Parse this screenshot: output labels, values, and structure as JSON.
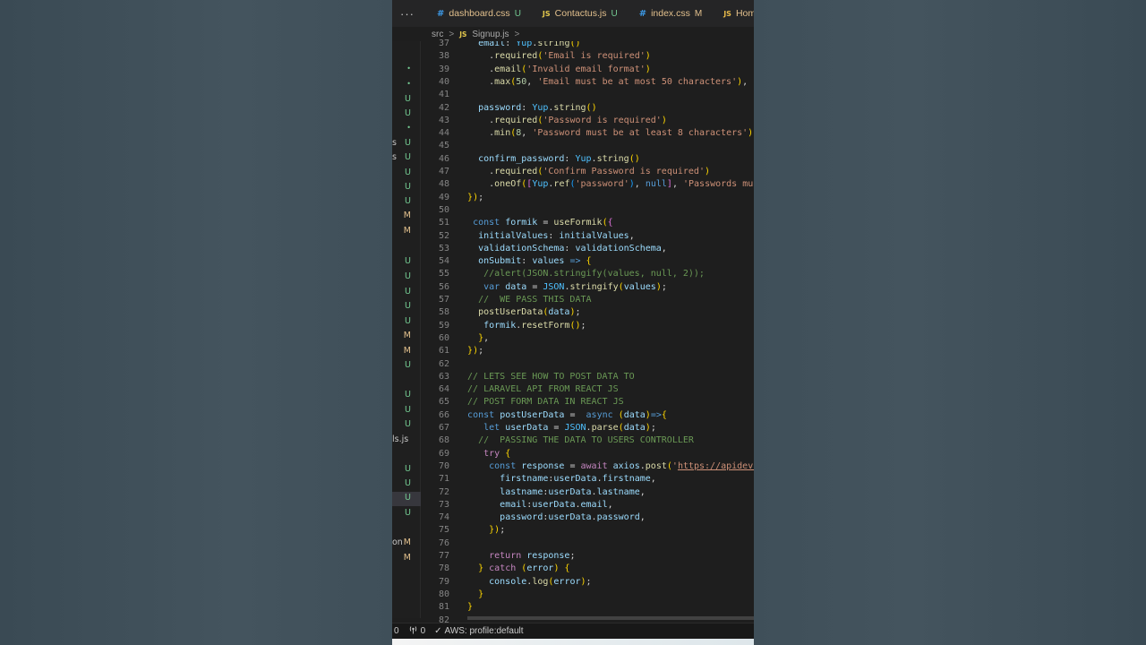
{
  "tabs": [
    {
      "icon": "#",
      "icon_kind": "css",
      "name": "dashboard.css",
      "status": "U"
    },
    {
      "icon": "JS",
      "icon_kind": "js",
      "name": "Contactus.js",
      "status": "U"
    },
    {
      "icon": "#",
      "icon_kind": "css",
      "name": "index.css",
      "status": "M"
    },
    {
      "icon": "JS",
      "icon_kind": "react",
      "name": "Hom",
      "status": ""
    }
  ],
  "tab_more": "···",
  "breadcrumb": {
    "folder": "src",
    "sep": ">",
    "file_icon": "JS",
    "file": "Signup.js",
    "sep2": ">"
  },
  "explorer": [
    {
      "lead": "",
      "status": "•",
      "kind": "dot"
    },
    {
      "lead": "",
      "status": "•",
      "kind": "dot"
    },
    {
      "lead": "",
      "status": "U",
      "kind": "U"
    },
    {
      "lead": "",
      "status": "U",
      "kind": "U"
    },
    {
      "lead": "",
      "status": "•",
      "kind": "dot"
    },
    {
      "lead": "s",
      "status": "U",
      "kind": "U"
    },
    {
      "lead": "s",
      "status": "U",
      "kind": "U"
    },
    {
      "lead": "",
      "status": "U",
      "kind": "U"
    },
    {
      "lead": "",
      "status": "U",
      "kind": "U"
    },
    {
      "lead": "",
      "status": "U",
      "kind": "U"
    },
    {
      "lead": "",
      "status": "M",
      "kind": "M"
    },
    {
      "lead": "",
      "status": "M",
      "kind": "M"
    },
    {
      "lead": "",
      "status": "",
      "kind": ""
    },
    {
      "lead": "",
      "status": "U",
      "kind": "U"
    },
    {
      "lead": "",
      "status": "U",
      "kind": "U"
    },
    {
      "lead": "",
      "status": "U",
      "kind": "U"
    },
    {
      "lead": "",
      "status": "U",
      "kind": "U"
    },
    {
      "lead": "",
      "status": "U",
      "kind": "U"
    },
    {
      "lead": "",
      "status": "M",
      "kind": "M"
    },
    {
      "lead": "",
      "status": "M",
      "kind": "M"
    },
    {
      "lead": "",
      "status": "U",
      "kind": "U"
    },
    {
      "lead": "",
      "status": "",
      "kind": ""
    },
    {
      "lead": "",
      "status": "U",
      "kind": "U"
    },
    {
      "lead": "",
      "status": "U",
      "kind": "U"
    },
    {
      "lead": "",
      "status": "U",
      "kind": "U"
    },
    {
      "lead": "ls.js",
      "status": "",
      "kind": ""
    },
    {
      "lead": "",
      "status": "",
      "kind": ""
    },
    {
      "lead": "",
      "status": "U",
      "kind": "U"
    },
    {
      "lead": "",
      "status": "U",
      "kind": "U"
    },
    {
      "lead": "",
      "status": "U",
      "kind": "U",
      "selected": true
    },
    {
      "lead": "",
      "status": "U",
      "kind": "U"
    },
    {
      "lead": "",
      "status": "",
      "kind": ""
    },
    {
      "lead": "on",
      "status": "M",
      "kind": "M"
    },
    {
      "lead": "",
      "status": "M",
      "kind": "M"
    }
  ],
  "code_lines": [
    {
      "n": "37",
      "t": "    email: Yup.string()"
    },
    {
      "n": "38",
      "t": "      .required('Email is required')"
    },
    {
      "n": "39",
      "t": "      .email('Invalid email format')"
    },
    {
      "n": "40",
      "t": "      .max(50, 'Email must be at most 50 characters'),"
    },
    {
      "n": "41",
      "t": ""
    },
    {
      "n": "42",
      "t": "    password: Yup.string()"
    },
    {
      "n": "43",
      "t": "      .required('Password is required')"
    },
    {
      "n": "44",
      "t": "      .min(8, 'Password must be at least 8 characters'),"
    },
    {
      "n": "45",
      "t": ""
    },
    {
      "n": "46",
      "t": "    confirm_password: Yup.string()"
    },
    {
      "n": "47",
      "t": "      .required('Confirm Password is required')"
    },
    {
      "n": "48",
      "t": "      .oneOf([Yup.ref('password'), null], 'Passwords must"
    },
    {
      "n": "49",
      "t": "  });"
    },
    {
      "n": "50",
      "t": ""
    },
    {
      "n": "51",
      "t": "   const formik = useFormik({"
    },
    {
      "n": "52",
      "t": "    initialValues: initialValues,"
    },
    {
      "n": "53",
      "t": "    validationSchema: validationSchema,"
    },
    {
      "n": "54",
      "t": "    onSubmit: values => {"
    },
    {
      "n": "55",
      "t": "     //alert(JSON.stringify(values, null, 2));"
    },
    {
      "n": "56",
      "t": "     var data = JSON.stringify(values);"
    },
    {
      "n": "57",
      "t": "    //  WE PASS THIS DATA"
    },
    {
      "n": "58",
      "t": "    postUserData(data);"
    },
    {
      "n": "59",
      "t": "     formik.resetForm();"
    },
    {
      "n": "60",
      "t": "    },"
    },
    {
      "n": "61",
      "t": "  });"
    },
    {
      "n": "62",
      "t": ""
    },
    {
      "n": "63",
      "t": "  // LETS SEE HOW TO POST DATA TO"
    },
    {
      "n": "64",
      "t": "  // LARAVEL API FROM REACT JS"
    },
    {
      "n": "65",
      "t": "  // POST FORM DATA IN REACT JS"
    },
    {
      "n": "66",
      "t": "  const postUserData =  async (data)=>{"
    },
    {
      "n": "67",
      "t": "     let userData = JSON.parse(data);"
    },
    {
      "n": "68",
      "t": "    //  PASSING THE DATA TO USERS CONTROLLER"
    },
    {
      "n": "69",
      "t": "     try {"
    },
    {
      "n": "70",
      "t": "      const response = await axios.post('https://apidev.le"
    },
    {
      "n": "71",
      "t": "        firstname:userData.firstname,"
    },
    {
      "n": "72",
      "t": "        lastname:userData.lastname,"
    },
    {
      "n": "73",
      "t": "        email:userData.email,"
    },
    {
      "n": "74",
      "t": "        password:userData.password,"
    },
    {
      "n": "75",
      "t": "      });"
    },
    {
      "n": "76",
      "t": ""
    },
    {
      "n": "77",
      "t": "      return response;"
    },
    {
      "n": "78",
      "t": "    } catch (error) {"
    },
    {
      "n": "79",
      "t": "      console.log(error);"
    },
    {
      "n": "80",
      "t": "    }"
    },
    {
      "n": "81",
      "t": "  }"
    },
    {
      "n": "82",
      "t": ""
    }
  ],
  "statusbar": {
    "errors": "0",
    "ports_icon": "radio-tower-icon",
    "ports": "0",
    "aws_check": "✓",
    "aws": "AWS: profile:default"
  },
  "colors": {
    "keyword": "#569cd6",
    "control": "#c586c0",
    "variable": "#9cdcfe",
    "function": "#dcdcaa",
    "string": "#ce9178",
    "comment": "#6a9955",
    "untracked": "#73c991",
    "modified": "#e2c08d"
  }
}
